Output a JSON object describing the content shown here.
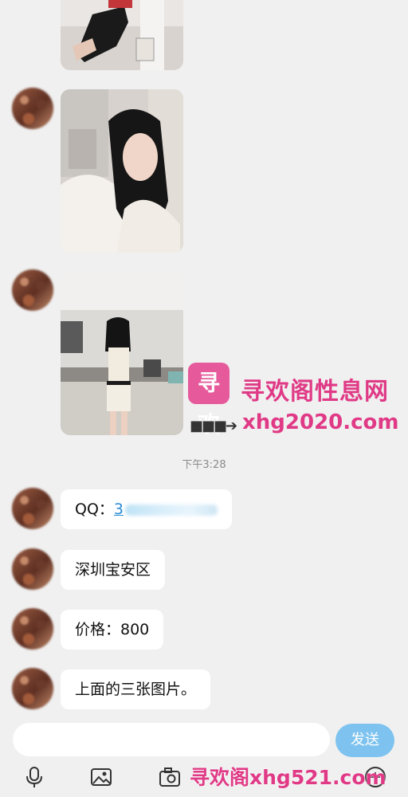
{
  "messages": {
    "time": "下午3:28",
    "qq_label": "QQ：",
    "qq_value": "3",
    "location": "深圳宝安区",
    "price": "价格：800",
    "note": "上面的三张图片。"
  },
  "input": {
    "placeholder": "",
    "send_label": "发送"
  },
  "watermark": {
    "logo_text": "寻欢",
    "title": "寻欢阁性息网",
    "arrow": "■■■➔",
    "url": "xhg2020.com",
    "footer": "寻欢阁xhg521.com"
  },
  "icons": {
    "mic": "microphone-icon",
    "image": "image-icon",
    "camera": "camera-icon",
    "plus": "plus-circle-icon"
  },
  "colors": {
    "background": "#f0f0f0",
    "bubble": "#ffffff",
    "send_button": "#7ec3ef",
    "link": "#2a8bd4",
    "watermark": "#e03a86"
  }
}
